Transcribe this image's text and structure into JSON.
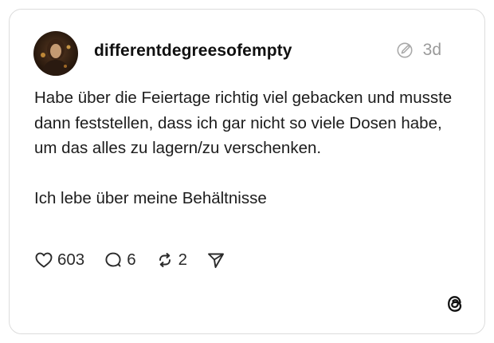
{
  "post": {
    "username": "differentdegreesofempty",
    "timestamp": "3d",
    "edited_icon": "edited-pen-icon",
    "body": {
      "paragraph1": "Habe über die Feiertage richtig viel gebacken und musste dann feststellen, dass ich gar nicht so viele Dosen habe, um das alles zu lagern/zu verschenken.",
      "paragraph2": "Ich lebe über meine Behältnisse"
    },
    "actions": {
      "likes": "603",
      "replies": "6",
      "reposts": "2"
    },
    "icons": {
      "like": "heart-icon",
      "reply": "comment-icon",
      "repost": "repost-icon",
      "share": "send-icon",
      "brand": "threads-logo-icon"
    }
  },
  "colors": {
    "text": "#1c1c1c",
    "muted": "#9a9a9a",
    "border": "#dcdcdc"
  }
}
